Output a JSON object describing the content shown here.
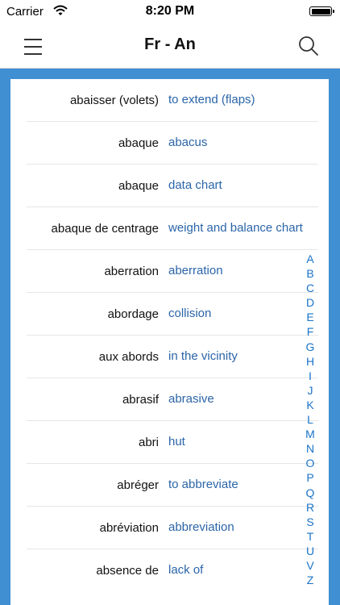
{
  "status": {
    "carrier": "Carrier",
    "time": "8:20 PM"
  },
  "header": {
    "title": "Fr - An"
  },
  "entries": [
    {
      "fr": "abaisser (volets)",
      "en": "to extend (flaps)"
    },
    {
      "fr": "abaque",
      "en": "abacus"
    },
    {
      "fr": "abaque",
      "en": "data chart"
    },
    {
      "fr": "abaque de centrage",
      "en": "weight and balance chart"
    },
    {
      "fr": "aberration",
      "en": "aberration"
    },
    {
      "fr": "abordage",
      "en": "collision"
    },
    {
      "fr": "aux abords",
      "en": "in the vicinity"
    },
    {
      "fr": "abrasif",
      "en": "abrasive"
    },
    {
      "fr": "abri",
      "en": "hut"
    },
    {
      "fr": "abréger",
      "en": "to abbreviate"
    },
    {
      "fr": "abréviation",
      "en": "abbreviation"
    },
    {
      "fr": "absence de",
      "en": "lack of"
    }
  ],
  "alphabet": [
    "A",
    "B",
    "C",
    "D",
    "E",
    "F",
    "G",
    "H",
    "I",
    "J",
    "K",
    "L",
    "M",
    "N",
    "O",
    "P",
    "Q",
    "R",
    "S",
    "T",
    "U",
    "V",
    "Z"
  ],
  "colors": {
    "frame": "#3f8fd2",
    "translation": "#2b65a8",
    "index": "#1a73c8"
  }
}
